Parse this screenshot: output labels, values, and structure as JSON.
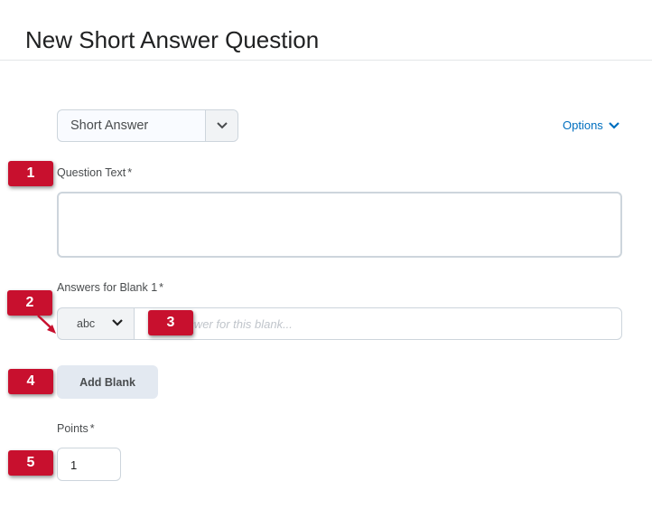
{
  "page": {
    "title": "New Short Answer Question"
  },
  "question_type": {
    "selected": "Short Answer"
  },
  "options_link": "Options",
  "question_text": {
    "label": "Question Text",
    "required_mark": "*",
    "value": ""
  },
  "answers": {
    "label": "Answers for Blank 1",
    "required_mark": "*",
    "type_selected": "abc",
    "placeholder": "Enter an answer for this blank...",
    "visible_placeholder": "n answer for this blank..."
  },
  "add_blank_label": "Add Blank",
  "points": {
    "label": "Points",
    "required_mark": "*",
    "value": "1"
  },
  "callouts": [
    "1",
    "2",
    "3",
    "4",
    "5"
  ],
  "colors": {
    "accent_link": "#006fbf",
    "callout_red": "#c8102e",
    "border": "#cdd5dc"
  },
  "icons": {
    "select_chevron": "chevron-down-icon",
    "options_chevron": "chevron-down-icon"
  }
}
